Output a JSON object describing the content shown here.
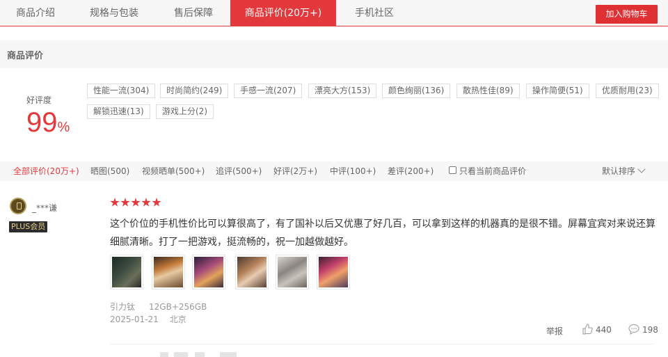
{
  "tabs": [
    {
      "label": "商品介绍",
      "active": false
    },
    {
      "label": "规格与包装",
      "active": false
    },
    {
      "label": "售后保障",
      "active": false
    },
    {
      "label": "商品评价(20万+)",
      "active": true
    },
    {
      "label": "手机社区",
      "active": false
    }
  ],
  "cart_button": "加入购物车",
  "section_title": "商品评价",
  "rating": {
    "label": "好评度",
    "value": "99",
    "unit": "%"
  },
  "tags": [
    "性能一流(304)",
    "时尚简约(249)",
    "手感一流(207)",
    "漂亮大方(153)",
    "颜色绚丽(136)",
    "散热性佳(89)",
    "操作简便(51)",
    "优质耐用(23)",
    "解锁迅速(13)",
    "游戏上分(2)"
  ],
  "filters": [
    {
      "label": "全部评价(20万+)",
      "active": true
    },
    {
      "label": "晒图(500)",
      "active": false
    },
    {
      "label": "视频晒单(500+)",
      "active": false
    },
    {
      "label": "追评(500+)",
      "active": false
    },
    {
      "label": "好评(2万+)",
      "active": false
    },
    {
      "label": "中评(100+)",
      "active": false
    },
    {
      "label": "差评(200+)",
      "active": false
    }
  ],
  "only_current": "只看当前商品评价",
  "sort_label": "默认排序",
  "review": {
    "username": "_***谦",
    "badge": "PLUS会员",
    "stars": 5,
    "content": "这个价位的手机性价比可以算很高了，有了国补以后又优惠了好几百，可以拿到这样的机器真的是很不错。屏幕宜宾对来说还算细腻清晰。打了一把游戏，挺流畅的，祝一加越做越好。",
    "image_count": 6,
    "color": "引力钛",
    "spec": "12GB+256GB",
    "date": "2025-01-21",
    "location": "北京",
    "report": "举报",
    "likes": "440",
    "comments": "198"
  }
}
